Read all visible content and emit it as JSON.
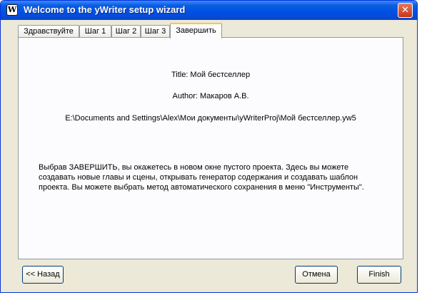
{
  "window": {
    "title": "Welcome to the yWriter setup wizard",
    "icon_letter": "W",
    "close_glyph": "✕"
  },
  "tabs": [
    {
      "label": "Здравствуйте"
    },
    {
      "label": "Шаг 1"
    },
    {
      "label": "Шаг 2"
    },
    {
      "label": "Шаг 3"
    },
    {
      "label": "Завершить"
    }
  ],
  "active_tab": "Завершить",
  "summary": {
    "title_line": "Title: Мой бестселлер",
    "author_line": "Author: Макаров А.В.",
    "path_line": "E:\\Documents and Settings\\Alex\\Мои документы\\yWriterProj\\Мой бестселлер.yw5"
  },
  "description": [
    "Выбрав ЗАВЕРШИТЬ, вы окажетесь в новом окне пустого проекта. Здесь вы можете",
    "создавать новые главы и сцены, открывать генератор содержания и создавать шаблон",
    "проекта. Вы можете выбрать метод автоматического сохранения в меню \"Инструменты\"."
  ],
  "buttons": {
    "back": "<< Назад",
    "cancel": "Отмена",
    "finish": "Finish"
  },
  "colors": {
    "titlebar": "#0a5ce0",
    "active_tab_accent": "#ffc83c",
    "dialog_bg": "#ece9d8"
  }
}
